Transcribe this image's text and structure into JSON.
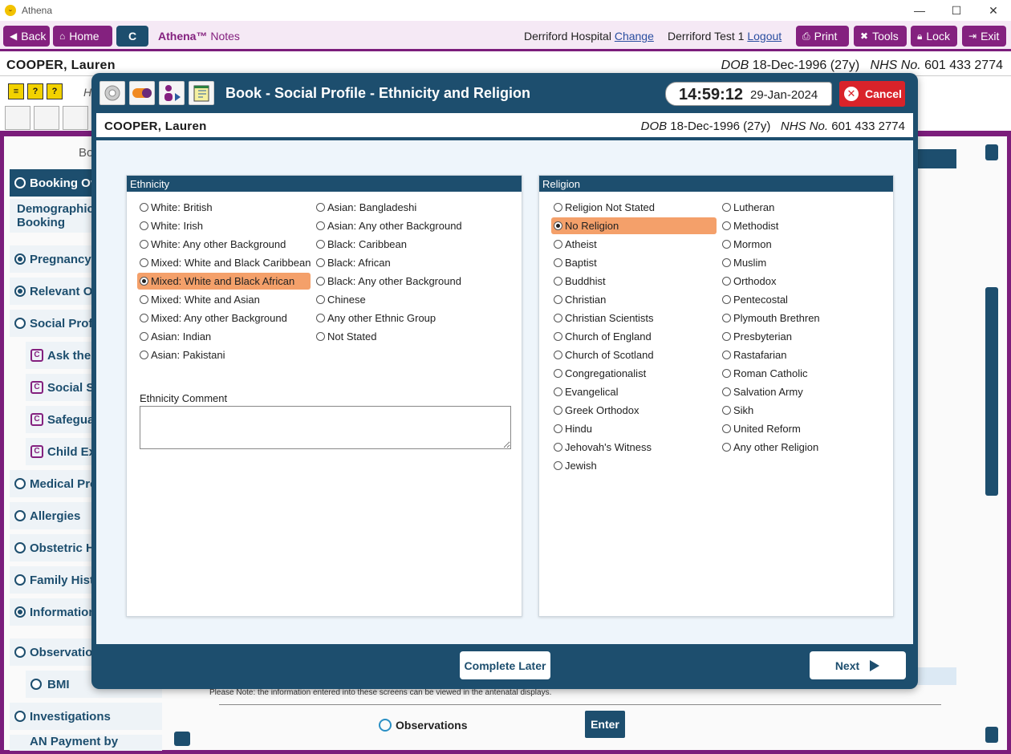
{
  "window": {
    "title": "Athena",
    "minimize": "—",
    "maximize": "☐",
    "close": "✕"
  },
  "toolbar": {
    "back": "Back",
    "home": "Home",
    "c": "C",
    "brand": "Athena™",
    "brand_suffix": "Notes",
    "hospital": "Derriford Hospital",
    "change": "Change",
    "user": "Derriford Test 1",
    "logout": "Logout",
    "print": "Print",
    "tools": "Tools",
    "lock": "Lock",
    "exit": "Exit"
  },
  "patient": {
    "name": "COOPER, Lauren",
    "dob_label": "DOB",
    "dob": "18-Dec-1996 (27y)",
    "nhs_label": "NHS No.",
    "nhs": "601 433 2774"
  },
  "background": {
    "sidebar": [
      {
        "label": "Booking Ov",
        "kind": "radio",
        "active": true
      },
      {
        "label": "Demographics",
        "label2": "Booking",
        "kind": "none"
      },
      {
        "label": "Pregnancy I",
        "kind": "radio-on"
      },
      {
        "label": "Relevant Ot",
        "kind": "radio-on"
      },
      {
        "label": "Social Profil",
        "kind": "radio"
      },
      {
        "label": "Ask the",
        "kind": "c"
      },
      {
        "label": "Social Se",
        "kind": "c"
      },
      {
        "label": "Safegua",
        "kind": "c"
      },
      {
        "label": "Child Exp",
        "kind": "c"
      },
      {
        "label": "Medical Pro",
        "kind": "radio"
      },
      {
        "label": "Allergies",
        "kind": "radio"
      },
      {
        "label": "Obstetric H",
        "kind": "radio"
      },
      {
        "label": "Family Histo",
        "kind": "radio"
      },
      {
        "label": "Information",
        "kind": "radio-on"
      },
      {
        "label": "Observation",
        "kind": "radio"
      },
      {
        "label": "BMI",
        "kind": "radio"
      },
      {
        "label": "Investigations",
        "kind": "radio"
      },
      {
        "label": "AN Payment by",
        "kind": "none"
      }
    ],
    "header_partial": "Bo",
    "header_partial2": "H",
    "note": "Please Note: the information entered into these screens can be viewed in the antenatal displays.",
    "observations": "Observations",
    "enter": "Enter"
  },
  "modal": {
    "title": "Book - Social Profile - Ethnicity and Religion",
    "time": "14:59:12",
    "date": "29-Jan-2024",
    "cancel": "Cancel",
    "ethnicity": {
      "heading": "Ethnicity",
      "col1": [
        "White: British",
        "White: Irish",
        "White: Any other Background",
        "Mixed: White and Black Caribbean",
        "Mixed: White and Black African",
        "Mixed: White and Asian",
        "Mixed: Any other Background",
        "Asian: Indian",
        "Asian: Pakistani"
      ],
      "col2": [
        "Asian: Bangladeshi",
        "Asian: Any other Background",
        "Black: Caribbean",
        "Black: African",
        "Black: Any other Background",
        "Chinese",
        "Any other Ethnic Group",
        "Not Stated"
      ],
      "selected": "Mixed: White and Black African",
      "comment_label": "Ethnicity Comment",
      "comment_value": ""
    },
    "religion": {
      "heading": "Religion",
      "col1": [
        "Religion Not Stated",
        "No Religion",
        "Atheist",
        "Baptist",
        "Buddhist",
        "Christian",
        "Christian Scientists",
        "Church of England",
        "Church of Scotland",
        "Congregationalist",
        "Evangelical",
        "Greek Orthodox",
        "Hindu",
        "Jehovah's Witness",
        "Jewish"
      ],
      "col2": [
        "Lutheran",
        "Methodist",
        "Mormon",
        "Muslim",
        "Orthodox",
        "Pentecostal",
        "Plymouth Brethren",
        "Presbyterian",
        "Rastafarian",
        "Roman Catholic",
        "Salvation Army",
        "Sikh",
        "United Reform",
        "Any other Religion"
      ],
      "selected": "No Religion"
    },
    "complete_later": "Complete Later",
    "next": "Next"
  },
  "colors": {
    "brand": "#84217f",
    "primary": "#1d4e6e",
    "selected": "#f4a06a",
    "cancel": "#d9232a"
  }
}
